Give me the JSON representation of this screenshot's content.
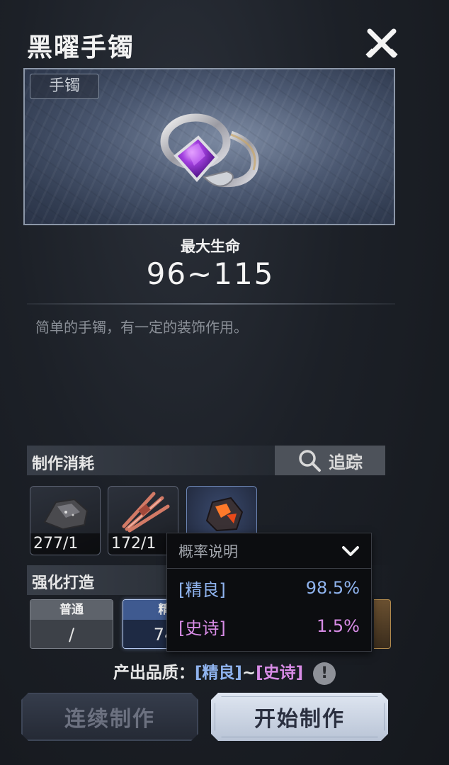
{
  "item": {
    "name": "黑曜手镯",
    "type_tag": "手镯",
    "stat_label": "最大生命",
    "stat_value": "96~115",
    "description": "简单的手镯，有一定的装饰作用。"
  },
  "materials": {
    "section_title": "制作消耗",
    "track_label": "追踪",
    "items": [
      {
        "icon": "rock-ore-icon",
        "count": "277/1"
      },
      {
        "icon": "red-fiber-bundle-icon",
        "count": "172/1"
      },
      {
        "icon": "molten-ore-icon",
        "count": ""
      }
    ]
  },
  "enhance": {
    "section_title": "强化打造",
    "options": [
      {
        "label": "普通",
        "value": "/"
      },
      {
        "label": "精",
        "value": "74"
      }
    ]
  },
  "probability_popup": {
    "title": "概率说明",
    "rows": [
      {
        "quality": "[精良]",
        "rate": "98.5%",
        "color": "#8fb3ee"
      },
      {
        "quality": "[史诗]",
        "rate": "1.5%",
        "color": "#d88ce6"
      }
    ]
  },
  "output_quality": {
    "prefix": "产出品质：",
    "low": "[精良]",
    "sep": "~",
    "high": "[史诗]",
    "info_icon": "!"
  },
  "buttons": {
    "continuous_craft": "连续制作",
    "start_craft": "开始制作"
  }
}
